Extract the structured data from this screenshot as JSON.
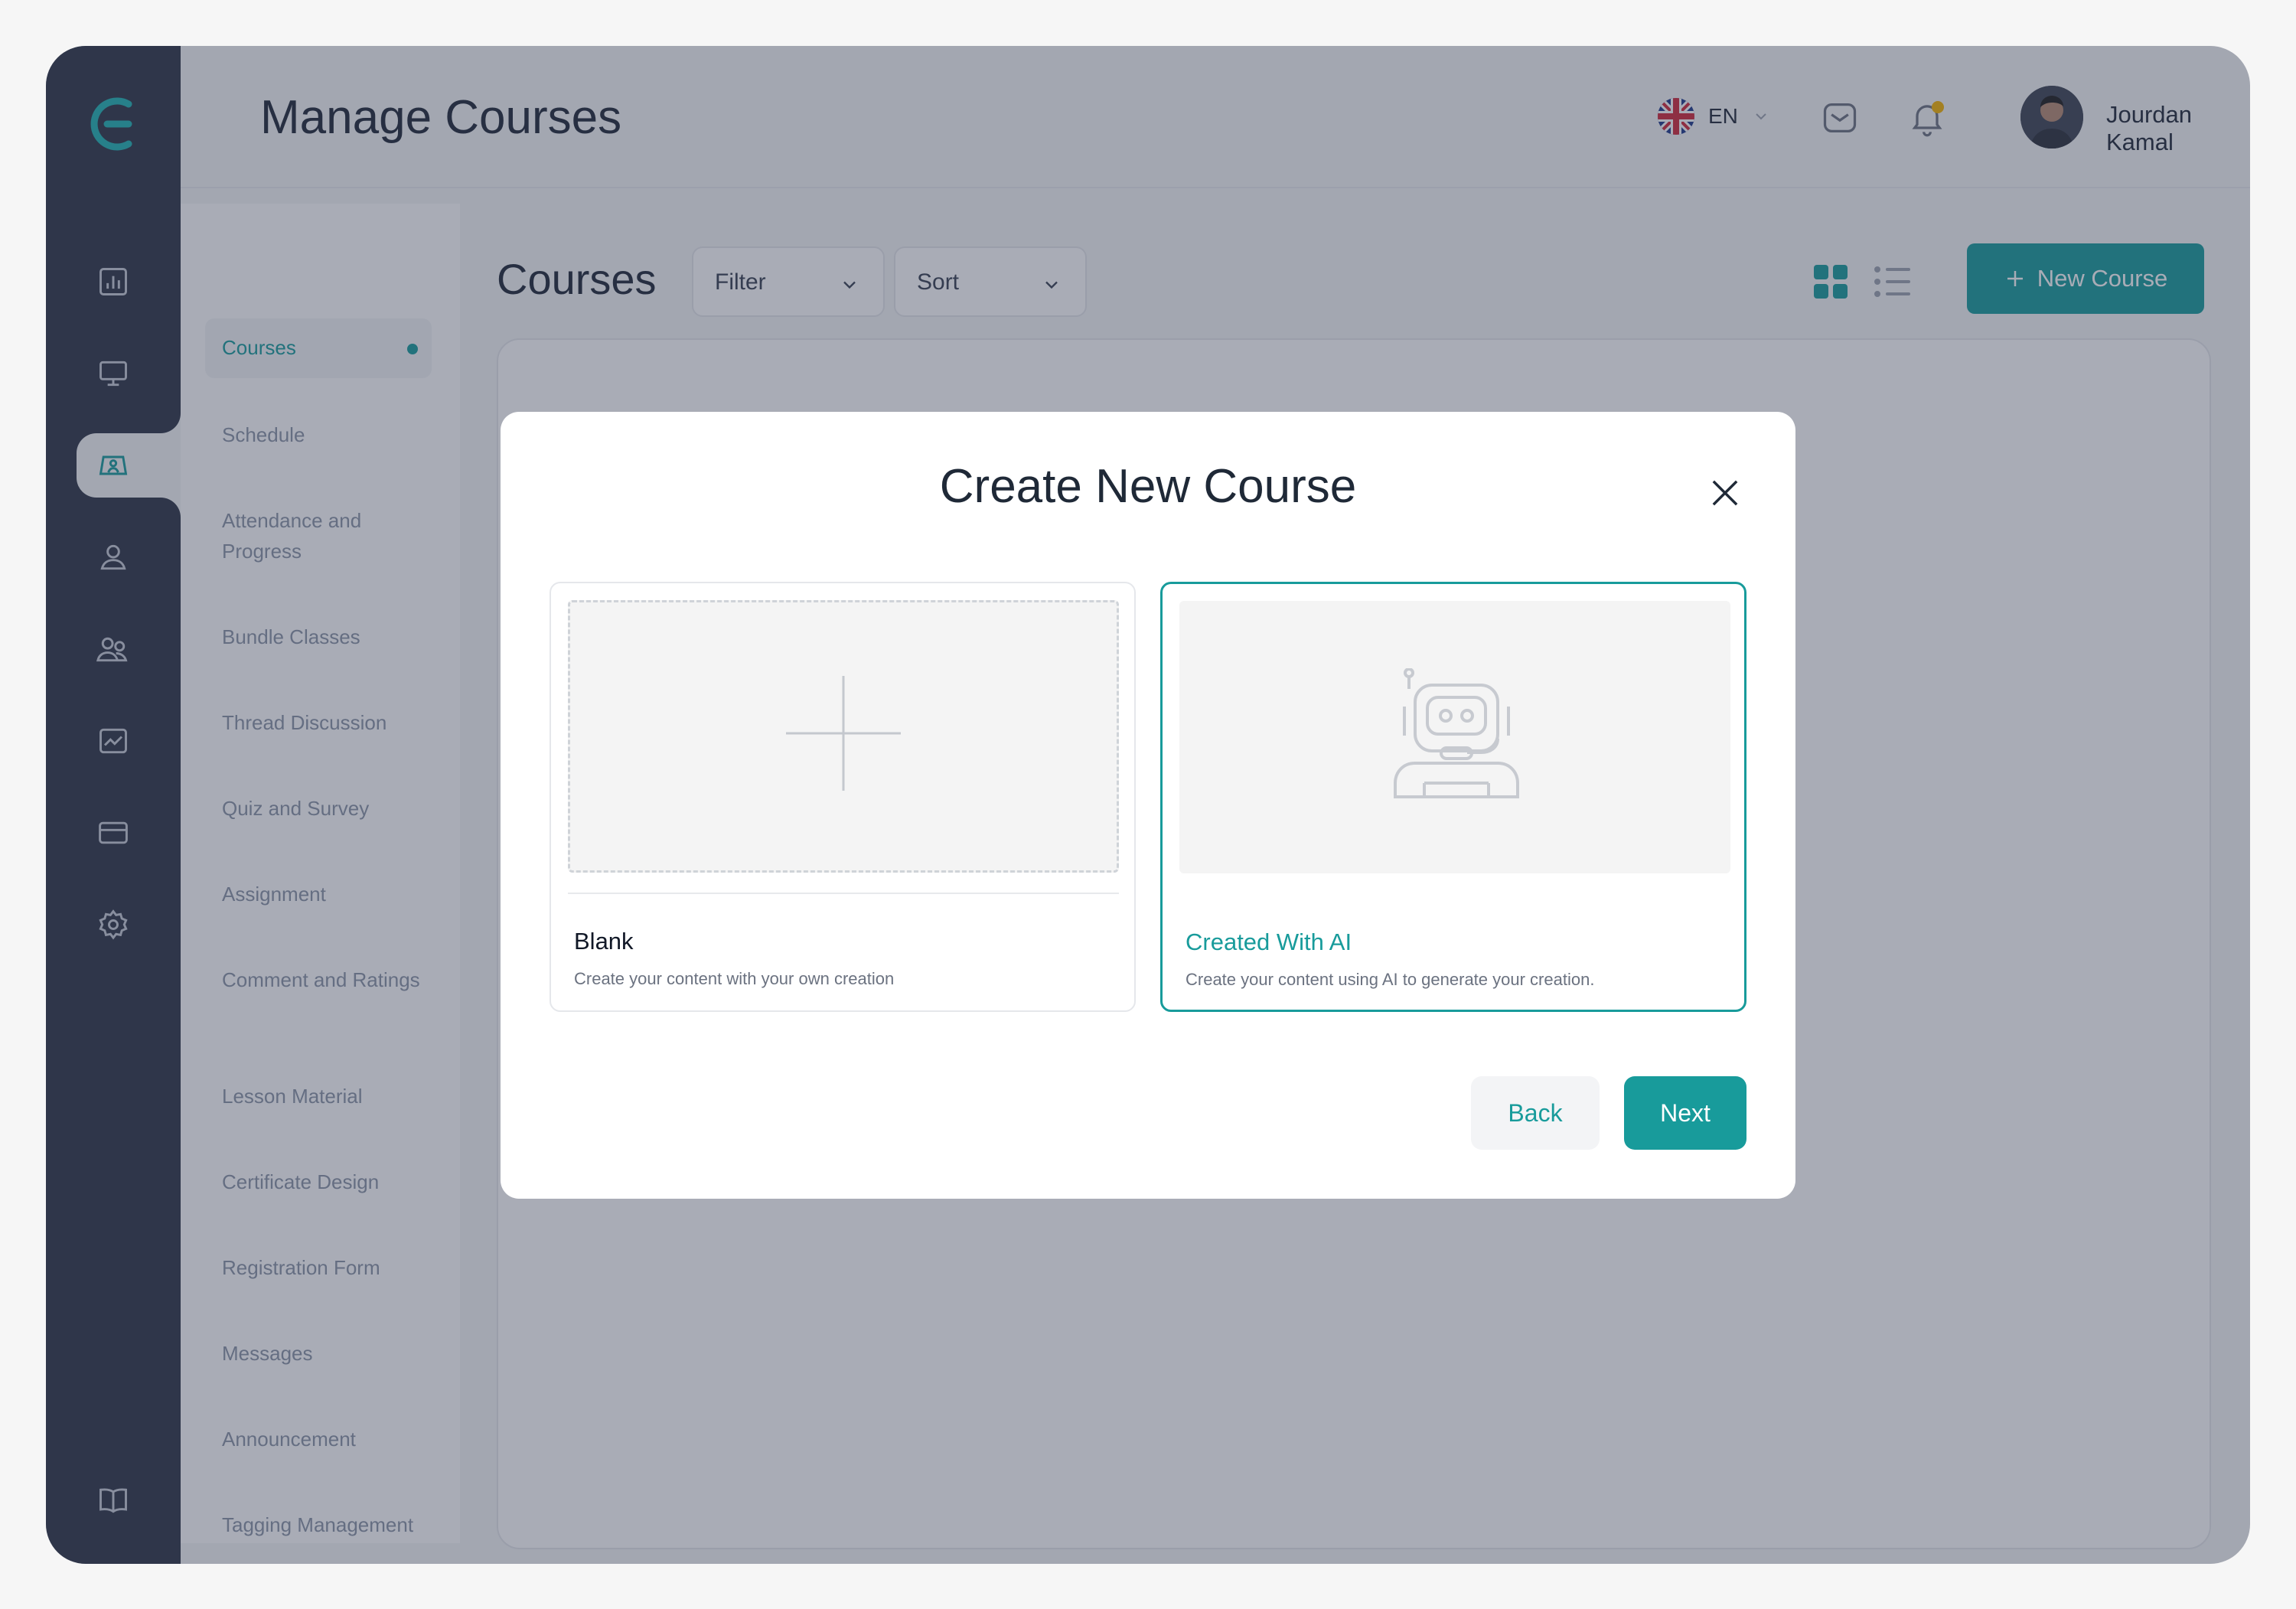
{
  "header": {
    "page_title": "Manage Courses",
    "language": "EN",
    "user_name": "Jourdan Kamal"
  },
  "subnav": {
    "items": [
      {
        "label": "Courses",
        "active": true
      },
      {
        "label": "Schedule"
      },
      {
        "label": "Attendance and Progress"
      },
      {
        "label": "Bundle Classes"
      },
      {
        "label": "Thread Discussion"
      },
      {
        "label": "Quiz and Survey"
      },
      {
        "label": "Assignment"
      },
      {
        "label": "Comment and Ratings"
      },
      {
        "label": "Lesson Material"
      },
      {
        "label": "Certificate Design"
      },
      {
        "label": "Registration Form"
      },
      {
        "label": "Messages"
      },
      {
        "label": "Announcement"
      },
      {
        "label": "Tagging Management"
      }
    ]
  },
  "rail": {
    "icons": [
      "dashboard-icon",
      "monitor-icon",
      "classroom-icon",
      "user-icon",
      "users-icon",
      "analytics-icon",
      "card-icon",
      "settings-icon",
      "book-icon"
    ],
    "active_index": 2
  },
  "main": {
    "title": "Courses",
    "filter_label": "Filter",
    "sort_label": "Sort",
    "new_course_label": "New Course"
  },
  "modal": {
    "title": "Create New Course",
    "options": [
      {
        "title": "Blank",
        "description": "Create your content with your own creation",
        "selected": false
      },
      {
        "title": "Created With AI",
        "description": "Create your content using AI to generate your creation.",
        "selected": true
      }
    ],
    "back_label": "Back",
    "next_label": "Next"
  },
  "colors": {
    "accent": "#189b9b",
    "rail": "#2d3546",
    "notification": "#f5b301"
  }
}
